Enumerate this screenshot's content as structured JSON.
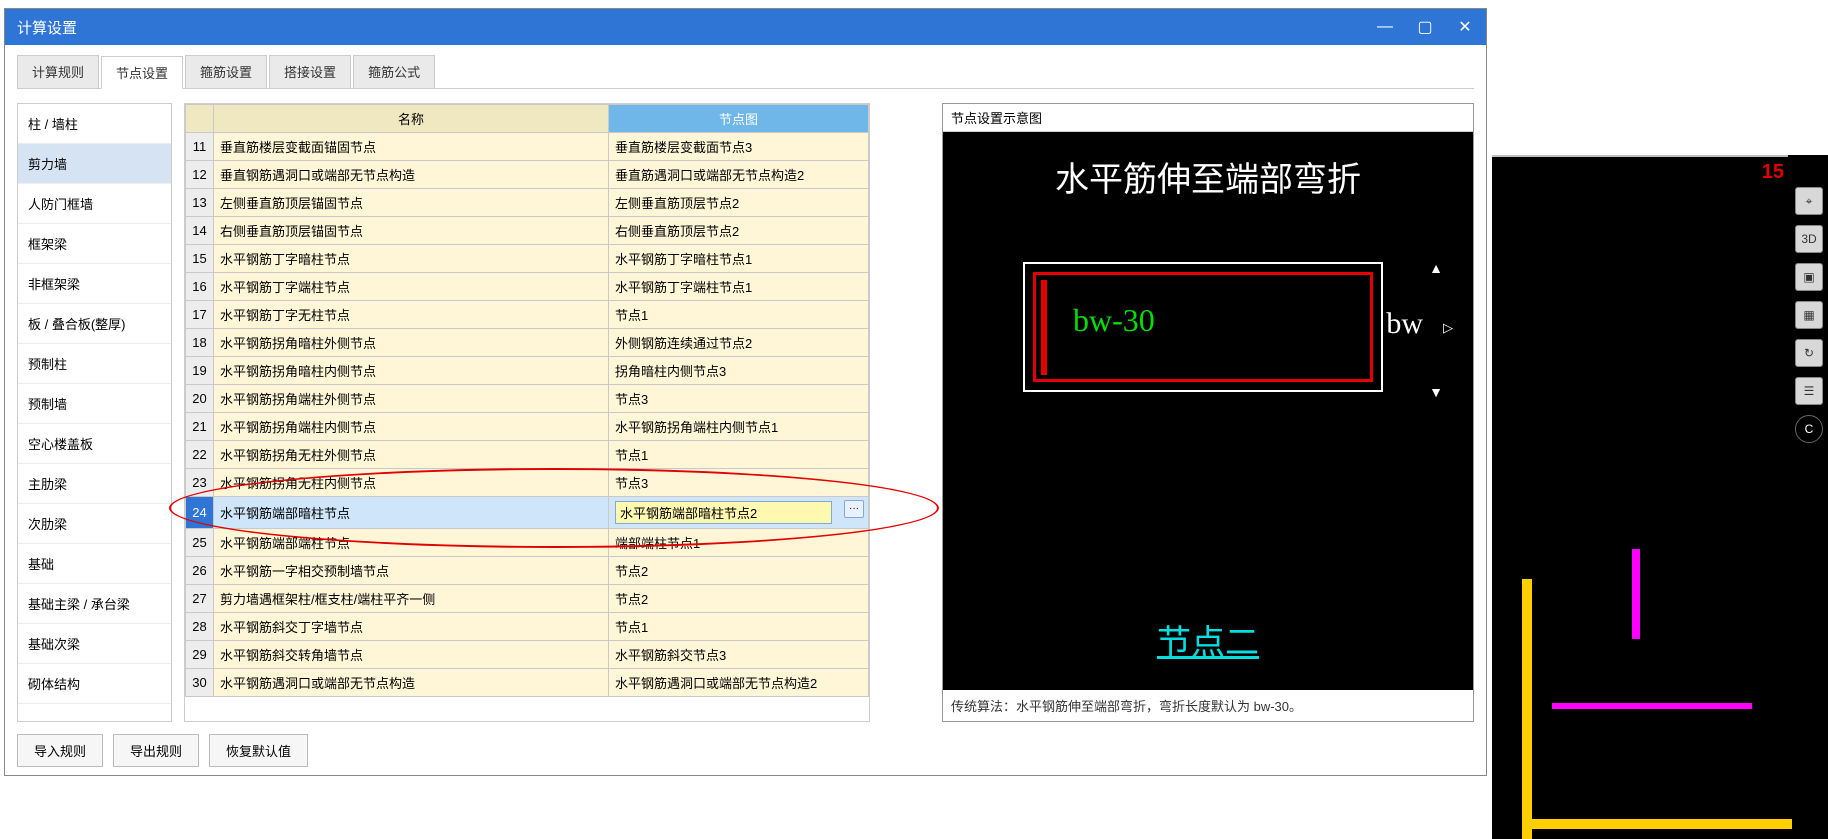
{
  "window": {
    "title": "计算设置"
  },
  "window_controls": {
    "min": "—",
    "max": "▢",
    "close": "✕"
  },
  "tabs": [
    {
      "label": "计算规则"
    },
    {
      "label": "节点设置"
    },
    {
      "label": "箍筋设置"
    },
    {
      "label": "搭接设置"
    },
    {
      "label": "箍筋公式"
    }
  ],
  "sidebar": {
    "items": [
      "柱 / 墙柱",
      "剪力墙",
      "人防门框墙",
      "框架梁",
      "非框架梁",
      "板 / 叠合板(整厚)",
      "预制柱",
      "预制墙",
      "空心楼盖板",
      "主肋梁",
      "次肋梁",
      "基础",
      "基础主梁 / 承台梁",
      "基础次梁",
      "砌体结构"
    ]
  },
  "table": {
    "headers": {
      "name": "名称",
      "diagram": "节点图"
    },
    "rows": [
      {
        "num": "11",
        "name": "垂直筋楼层变截面锚固节点",
        "diagram": "垂直筋楼层变截面节点3"
      },
      {
        "num": "12",
        "name": "垂直钢筋遇洞口或端部无节点构造",
        "diagram": "垂直筋遇洞口或端部无节点构造2"
      },
      {
        "num": "13",
        "name": "左侧垂直筋顶层锚固节点",
        "diagram": "左侧垂直筋顶层节点2"
      },
      {
        "num": "14",
        "name": "右侧垂直筋顶层锚固节点",
        "diagram": "右侧垂直筋顶层节点2"
      },
      {
        "num": "15",
        "name": "水平钢筋丁字暗柱节点",
        "diagram": "水平钢筋丁字暗柱节点1"
      },
      {
        "num": "16",
        "name": "水平钢筋丁字端柱节点",
        "diagram": "水平钢筋丁字端柱节点1"
      },
      {
        "num": "17",
        "name": "水平钢筋丁字无柱节点",
        "diagram": "节点1"
      },
      {
        "num": "18",
        "name": "水平钢筋拐角暗柱外侧节点",
        "diagram": "外侧钢筋连续通过节点2"
      },
      {
        "num": "19",
        "name": "水平钢筋拐角暗柱内侧节点",
        "diagram": "拐角暗柱内侧节点3"
      },
      {
        "num": "20",
        "name": "水平钢筋拐角端柱外侧节点",
        "diagram": "节点3"
      },
      {
        "num": "21",
        "name": "水平钢筋拐角端柱内侧节点",
        "diagram": "水平钢筋拐角端柱内侧节点1"
      },
      {
        "num": "22",
        "name": "水平钢筋拐角无柱外侧节点",
        "diagram": "节点1"
      },
      {
        "num": "23",
        "name": "水平钢筋拐角无柱内侧节点",
        "diagram": "节点3"
      },
      {
        "num": "24",
        "name": "水平钢筋端部暗柱节点",
        "diagram": "水平钢筋端部暗柱节点2"
      },
      {
        "num": "25",
        "name": "水平钢筋端部端柱节点",
        "diagram": "端部端柱节点1"
      },
      {
        "num": "26",
        "name": "水平钢筋一字相交预制墙节点",
        "diagram": "节点2"
      },
      {
        "num": "27",
        "name": "剪力墙遇框架柱/框支柱/端柱平齐一侧",
        "diagram": "节点2"
      },
      {
        "num": "28",
        "name": "水平钢筋斜交丁字墙节点",
        "diagram": "节点1"
      },
      {
        "num": "29",
        "name": "水平钢筋斜交转角墙节点",
        "diagram": "水平钢筋斜交节点3"
      },
      {
        "num": "30",
        "name": "水平钢筋遇洞口或端部无节点构造",
        "diagram": "水平钢筋遇洞口或端部无节点构造2"
      }
    ],
    "ellipsis_btn": "···"
  },
  "diagram_panel": {
    "title": "节点设置示意图",
    "heading": "水平筋伸至端部弯折",
    "bw30": "bw-30",
    "bw": "bw",
    "node_label": "节点二",
    "footer": "传统算法：水平钢筋伸至端部弯折，弯折长度默认为 bw-30。"
  },
  "buttons": {
    "import": "导入规则",
    "export": "导出规则",
    "restore": "恢复默认值"
  },
  "cad": {
    "num": "15",
    "icons": [
      "⌖",
      "3D",
      "▣",
      "▦",
      "↻",
      "☰"
    ],
    "circle": "C"
  }
}
